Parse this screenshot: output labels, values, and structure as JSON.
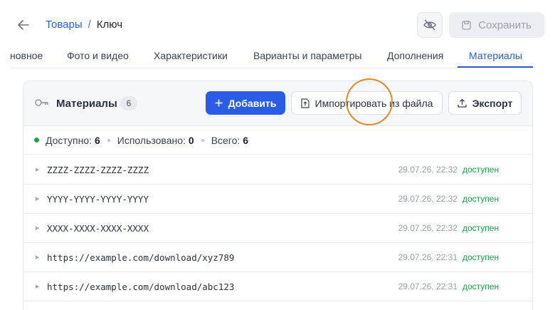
{
  "breadcrumb": {
    "parent": "Товары",
    "separator": "/",
    "current": "Ключ"
  },
  "header": {
    "save_label": "Сохранить"
  },
  "tabs": [
    {
      "label": "новное"
    },
    {
      "label": "Фото и видео"
    },
    {
      "label": "Характеристики"
    },
    {
      "label": "Варианты и параметры"
    },
    {
      "label": "Дополнения"
    },
    {
      "label": "Материалы",
      "active": true
    }
  ],
  "panel": {
    "title": "Материалы",
    "count": "6",
    "add_label": "Добавить",
    "import_label": "Импортировать из файла",
    "export_label": "Экспорт"
  },
  "stats": {
    "available_label": "Доступно:",
    "available_value": "6",
    "used_label": "Использовано:",
    "used_value": "0",
    "total_label": "Всего:",
    "total_value": "6"
  },
  "rows": [
    {
      "code": "ZZZZ-ZZZZ-ZZZZ-ZZZZ",
      "date": "29.07.26, 22:32",
      "status": "доступен"
    },
    {
      "code": "YYYY-YYYY-YYYY-YYYY",
      "date": "29.07.26, 22:32",
      "status": "доступен"
    },
    {
      "code": "XXXX-XXXX-XXXX-XXXX",
      "date": "29.07.26, 22:32",
      "status": "доступен"
    },
    {
      "code": "https://example.com/download/xyz789",
      "date": "29.07.26, 22:31",
      "status": "доступен"
    },
    {
      "code": "https://example.com/download/abc123",
      "date": "29.07.26, 22:31",
      "status": "доступен"
    }
  ],
  "colors": {
    "accent": "#2b5ce6",
    "link": "#2a5fd9",
    "status_ok": "#1f9d4a",
    "cursor_ring": "#e08a2c"
  },
  "icons": [
    "arrow-left-icon",
    "eye-off-icon",
    "save-icon",
    "key-icon",
    "plus-icon",
    "file-import-icon",
    "upload-icon",
    "caret-right-icon"
  ]
}
